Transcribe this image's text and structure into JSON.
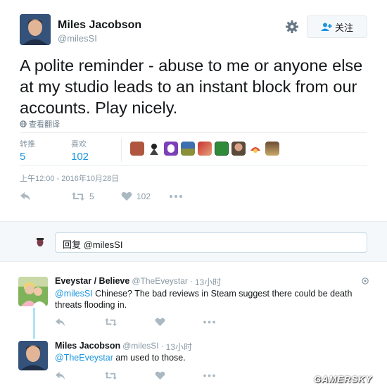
{
  "tweet": {
    "author_name": "Miles Jacobson",
    "author_handle": "@milesSI",
    "follow_label": "关注",
    "text": "A polite reminder - abuse to me or anyone else at my studio leads to an instant block from our accounts. Play nicely.",
    "translate_label": "查看翻译",
    "retweets_label": "转推",
    "retweets_count": "5",
    "likes_label": "喜欢",
    "likes_count": "102",
    "timestamp": "上午12:00 - 2016年10月28日",
    "action_retweet_count": "5",
    "action_like_count": "102"
  },
  "reply_box": {
    "placeholder": "回复 @milesSI"
  },
  "replies": [
    {
      "author_name": "Eveystar / Believe",
      "author_handle": "@TheEveystar",
      "separator": "·",
      "time": "13小时",
      "mention": "@milesSI",
      "text": "Chinese? The bad reviews in Steam suggest there could be death threats flooding in."
    },
    {
      "author_name": "Miles Jacobson",
      "author_handle": "@milesSI",
      "separator": "·",
      "time": "13小时",
      "mention": "@TheEveystar",
      "text": "am used to those."
    }
  ],
  "watermark": "GAMERSKY",
  "colors": {
    "accent": "#1b95e0",
    "muted": "#8899a6",
    "icon": "#aab8c2",
    "reply_bg": "#f5f8fa",
    "thread_line": "#aee4f5"
  }
}
